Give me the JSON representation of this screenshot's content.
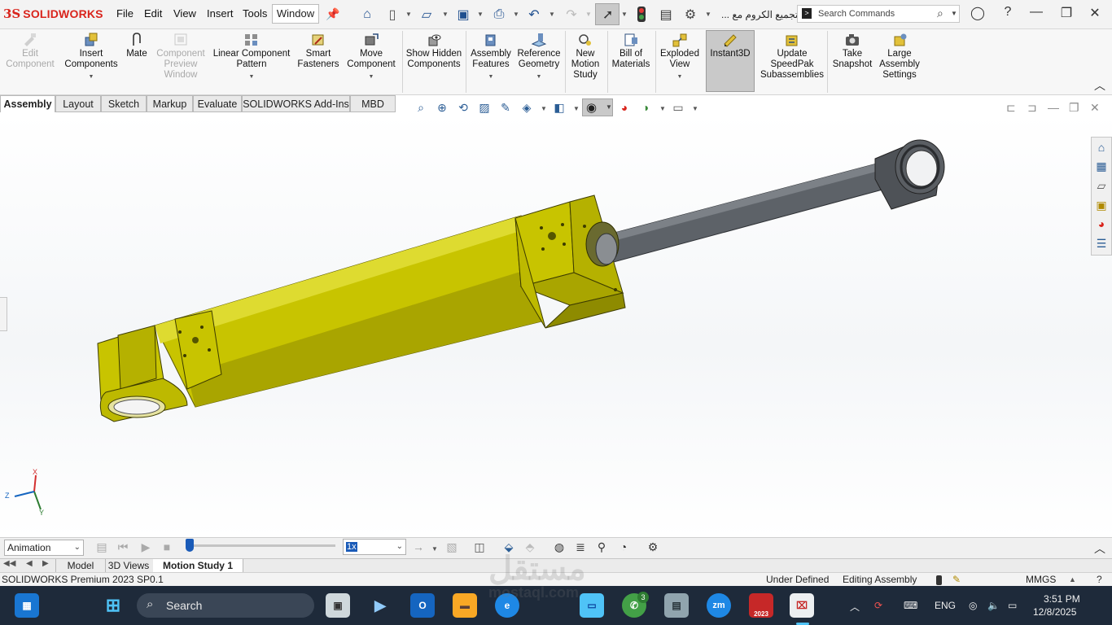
{
  "app": {
    "logo_mark": "3S",
    "logo_text": "SOLIDWORKS",
    "document_title": "تجميع الكروم مع ..."
  },
  "menu": {
    "items": [
      "File",
      "Edit",
      "View",
      "Insert",
      "Tools"
    ],
    "window": "Window"
  },
  "search": {
    "placeholder": "Search Commands"
  },
  "command_manager": {
    "edit_component": "Edit Component",
    "insert_components": "Insert Components",
    "mate": "Mate",
    "component_preview": "Component Preview Window",
    "linear_pattern": "Linear Component Pattern",
    "smart_fasteners": "Smart Fasteners",
    "move_component": "Move Component",
    "show_hidden": "Show Hidden Components",
    "assembly_features": "Assembly Features",
    "reference_geometry": "Reference Geometry",
    "new_motion_study": "New Motion Study",
    "bill_of_materials": "Bill of Materials",
    "exploded_view": "Exploded View",
    "instant3d": "Instant3D",
    "update_speedpak": "Update SpeedPak Subassemblies",
    "take_snapshot": "Take Snapshot",
    "large_assembly": "Large Assembly Settings"
  },
  "tabs": [
    "Assembly",
    "Layout",
    "Sketch",
    "Markup",
    "Evaluate",
    "SOLIDWORKS Add-Ins",
    "MBD"
  ],
  "active_tab": "Assembly",
  "triad": {
    "x": "X",
    "y": "Y",
    "z": "Z"
  },
  "motion_manager": {
    "study_type": "Animation",
    "speed": "1x",
    "timeline_position": 0.0
  },
  "bottom_tabs": [
    "Model",
    "3D Views",
    "Motion Study 1"
  ],
  "status_bar": {
    "product": "SOLIDWORKS Premium 2023 SP0.1",
    "definition": "Under Defined",
    "mode": "Editing Assembly",
    "units": "MMGS"
  },
  "taskbar": {
    "search_label": "Search",
    "whatsapp_badge": "3",
    "zoom_label": "zm",
    "sw_label": "2023",
    "language": "ENG",
    "time": "3:51 PM",
    "date": "12/8/2025"
  },
  "watermark": {
    "arabic": "مستقل",
    "latin": "mostaql.com"
  },
  "colors": {
    "accent_red": "#d9241c",
    "cylinder_yellow": "#c8c400",
    "rod_gray": "#5a5e63",
    "taskbar_bg": "#1e2a3a"
  }
}
